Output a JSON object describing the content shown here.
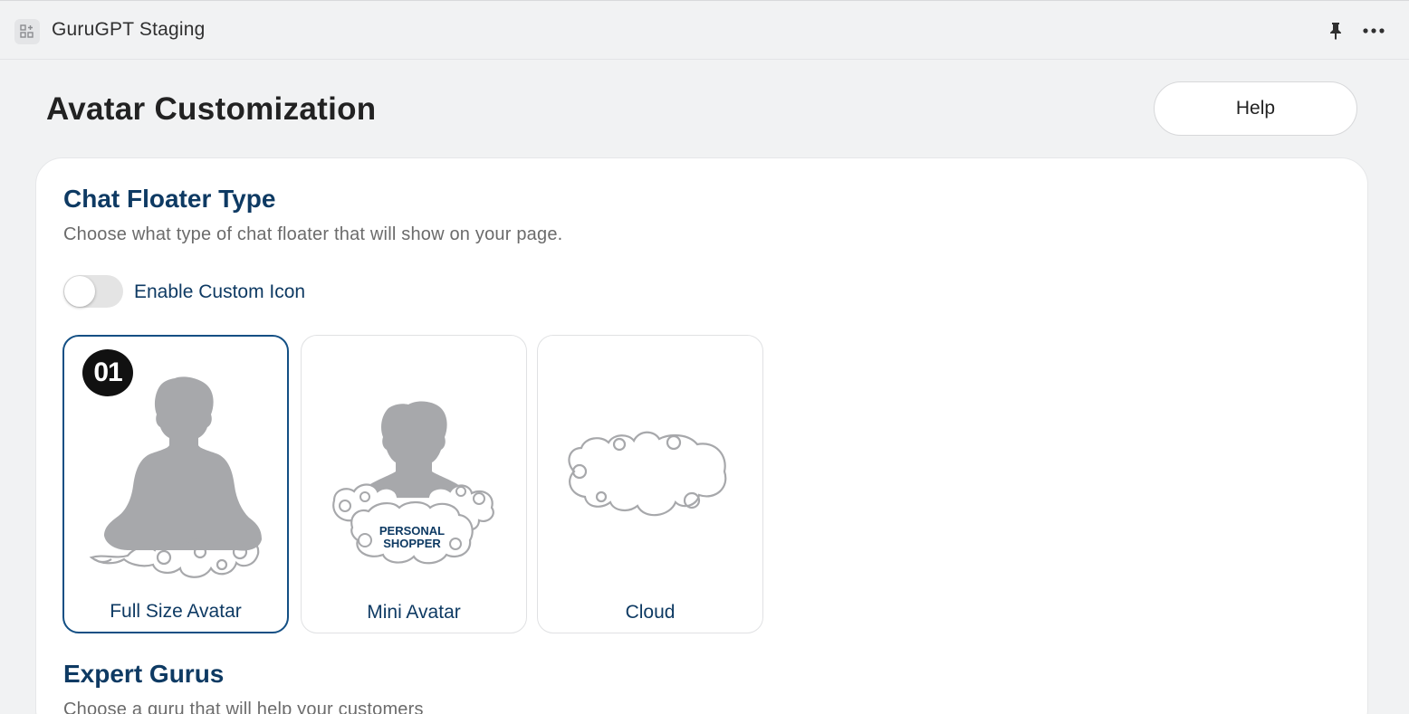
{
  "app": {
    "title": "GuruGPT Staging"
  },
  "header": {
    "title": "Avatar Customization",
    "help_label": "Help"
  },
  "chat_floater": {
    "title": "Chat Floater Type",
    "description": "Choose what type of chat floater that will show on your page.",
    "toggle_label": "Enable Custom Icon",
    "toggle_on": false,
    "options": [
      {
        "label": "Full Size Avatar",
        "badge": "01",
        "selected": true
      },
      {
        "label": "Mini Avatar",
        "art_text_line1": "PERSONAL",
        "art_text_line2": "SHOPPER",
        "selected": false
      },
      {
        "label": "Cloud",
        "selected": false
      }
    ]
  },
  "expert_gurus": {
    "title": "Expert Gurus",
    "description": "Choose a guru that will help your customers"
  },
  "colors": {
    "accent": "#134f84",
    "heading": "#0e3a63",
    "silhouette": "#a7a8ab"
  },
  "icons": {
    "app": "apps-add-icon",
    "pin": "pin-icon",
    "more": "more-horizontal-icon"
  }
}
